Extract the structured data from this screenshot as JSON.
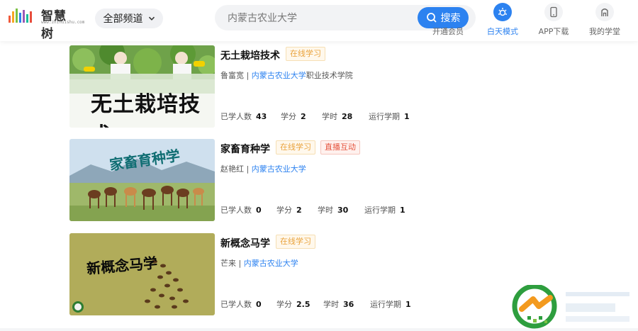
{
  "header": {
    "logo_text": "智慧树",
    "logo_url": "www.zhihuishu.com",
    "channel_label": "全部频道",
    "search": {
      "value": "",
      "placeholder": "内蒙古农业大学",
      "button_label": "搜索"
    },
    "nav": [
      {
        "label": "开通会员",
        "icon": "member-icon"
      },
      {
        "label": "白天模式",
        "icon": "day-mode-icon",
        "active": true
      },
      {
        "label": "APP下载",
        "icon": "phone-icon"
      },
      {
        "label": "我的学堂",
        "icon": "home-icon"
      }
    ]
  },
  "courses": [
    {
      "title": "无土栽培技术",
      "tags": [
        "在线学习"
      ],
      "teacher": "鲁富宽",
      "org": "内蒙古农业大学",
      "org_suffix": "职业技术学院",
      "stats": [
        {
          "label": "已学人数",
          "value": "43"
        },
        {
          "label": "学分",
          "value": "2"
        },
        {
          "label": "学时",
          "value": "28"
        },
        {
          "label": "运行学期",
          "value": "1"
        }
      ],
      "thumb_title": "无土栽培技术"
    },
    {
      "title": "家畜育种学",
      "tags": [
        "在线学习",
        "直播互动"
      ],
      "teacher": "赵艳红",
      "org": "内蒙古农业大学",
      "org_suffix": "",
      "stats": [
        {
          "label": "已学人数",
          "value": "0"
        },
        {
          "label": "学分",
          "value": "2"
        },
        {
          "label": "学时",
          "value": "30"
        },
        {
          "label": "运行学期",
          "value": "1"
        }
      ],
      "thumb_title": "家畜育种学"
    },
    {
      "title": "新概念马学",
      "tags": [
        "在线学习"
      ],
      "teacher": "芒来",
      "org": "内蒙古农业大学",
      "org_suffix": "",
      "stats": [
        {
          "label": "已学人数",
          "value": "0"
        },
        {
          "label": "学分",
          "value": "2.5"
        },
        {
          "label": "学时",
          "value": "36"
        },
        {
          "label": "运行学期",
          "value": "1"
        }
      ],
      "thumb_title": "新概念马学"
    }
  ],
  "colors": {
    "accent": "#2c82f0",
    "tag_online": "#e9a23b",
    "tag_live": "#e5533d"
  }
}
